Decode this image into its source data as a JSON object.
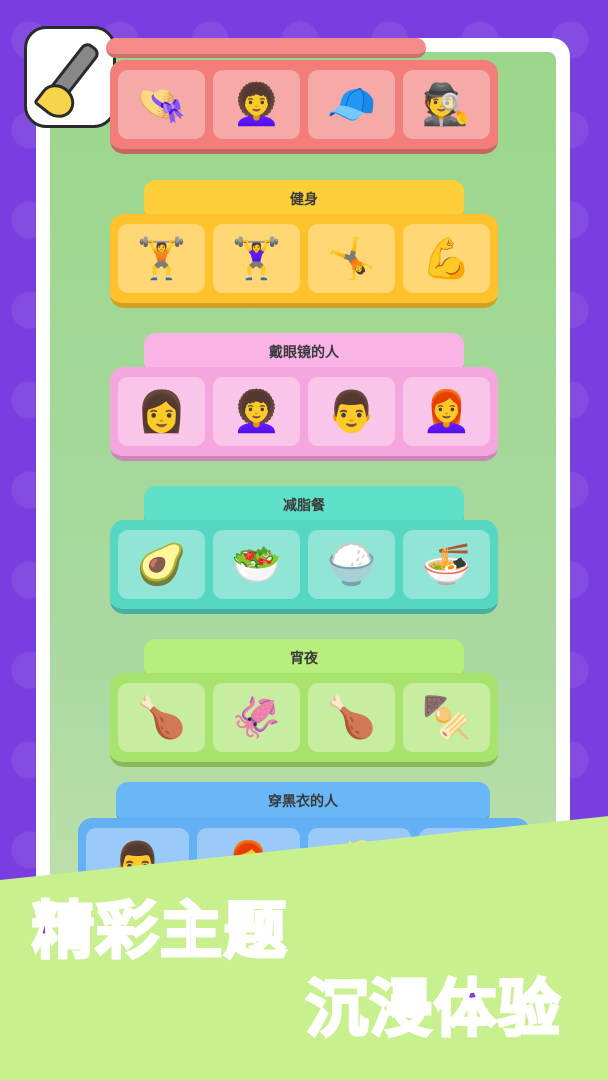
{
  "groups": [
    {
      "label": "",
      "items": [
        "👒",
        "👩‍🦱",
        "🧢",
        "🕵️"
      ]
    },
    {
      "label": "健身",
      "items": [
        "🏋️",
        "🏋️‍♀️",
        "🤸",
        "💪"
      ]
    },
    {
      "label": "戴眼镜的人",
      "items": [
        "👩",
        "👩‍🦱",
        "👨",
        "👩‍🦰"
      ]
    },
    {
      "label": "减脂餐",
      "items": [
        "🥑",
        "🥗",
        "🍚",
        "🍜"
      ]
    },
    {
      "label": "宵夜",
      "items": [
        "🍗",
        "🦑",
        "🍗",
        "🍢"
      ]
    },
    {
      "label": "穿黑衣的人",
      "items": [
        "👨",
        "👩‍🦰",
        "👱",
        "🧑"
      ]
    }
  ],
  "slogan": {
    "line1": "精彩主题",
    "line2": "沉浸体验"
  },
  "icons": {
    "paint-brush": "paint-brush-icon"
  },
  "colors": {
    "accent": "#7b3fe3",
    "band": "#c9f08f"
  }
}
